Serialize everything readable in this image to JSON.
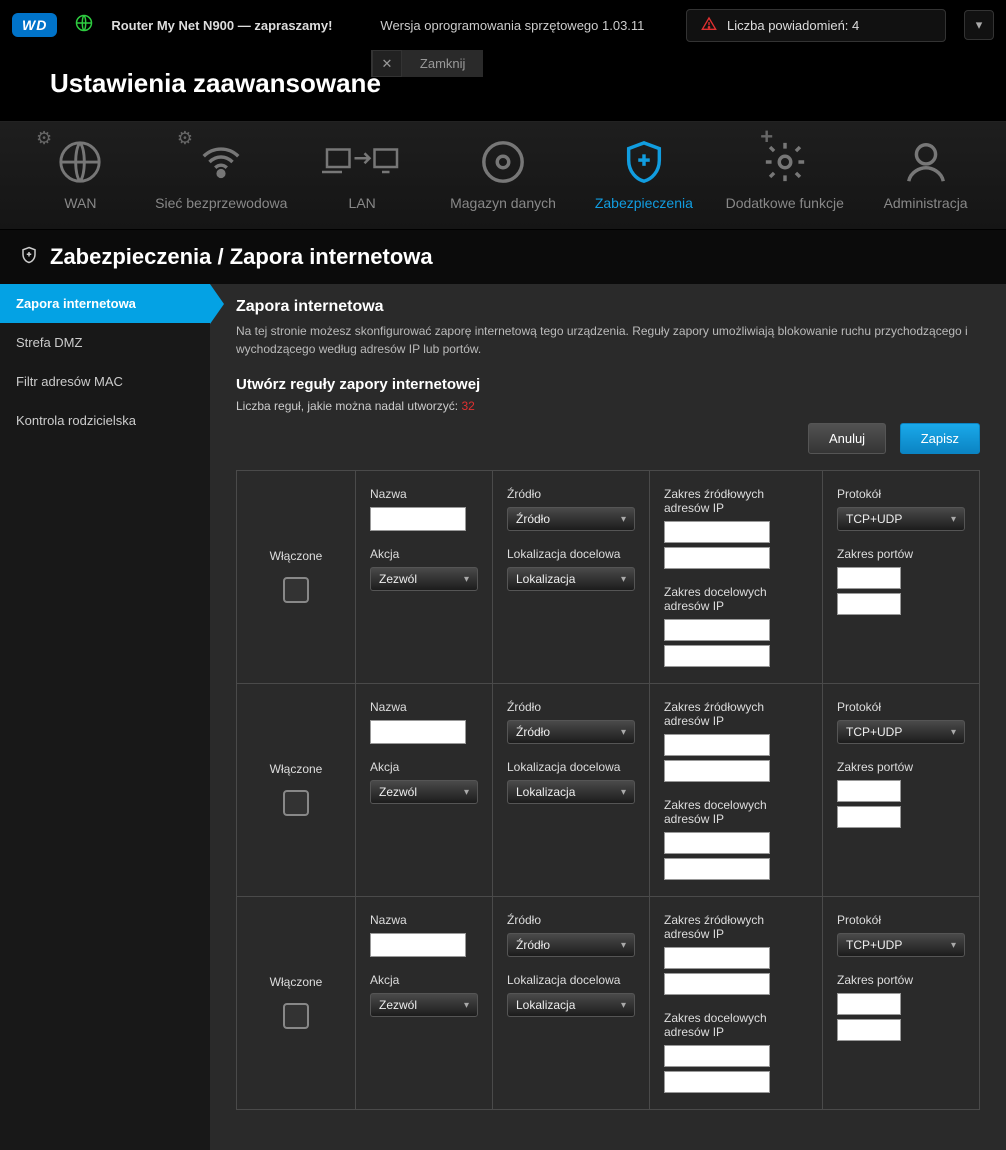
{
  "top": {
    "logo": "WD",
    "welcome": "Router My Net N900 — zapraszamy!",
    "firmware": "Wersja oprogramowania sprzętowego 1.03.11",
    "notif_label": "Liczba powiadomień:",
    "notif_count": "4"
  },
  "title": "Ustawienia zaawansowane",
  "close_label": "Zamknij",
  "nav": {
    "wan": "WAN",
    "wireless": "Sieć bezprzewodowa",
    "lan": "LAN",
    "storage": "Magazyn danych",
    "security": "Zabezpieczenia",
    "features": "Dodatkowe funkcje",
    "admin": "Administracja"
  },
  "breadcrumb": "Zabezpieczenia / Zapora internetowa",
  "sidebar": {
    "firewall": "Zapora internetowa",
    "dmz": "Strefa DMZ",
    "mac": "Filtr adresów MAC",
    "parental": "Kontrola rodzicielska"
  },
  "section": {
    "title": "Zapora internetowa",
    "desc": "Na tej stronie możesz skonfigurować zaporę internetową tego urządzenia. Reguły zapory umożliwiają blokowanie ruchu przychodzącego i wychodzącego według adresów IP lub portów.",
    "create_title": "Utwórz reguły zapory internetowej",
    "remain_lbl": "Liczba reguł, jakie można nadal utworzyć:",
    "remain_val": "32"
  },
  "buttons": {
    "cancel": "Anuluj",
    "save": "Zapisz"
  },
  "fields": {
    "enabled": "Włączone",
    "name": "Nazwa",
    "action": "Akcja",
    "action_val": "Zezwól",
    "source": "Źródło",
    "source_val": "Źródło",
    "dest": "Lokalizacja docelowa",
    "dest_val": "Lokalizacja",
    "src_ip": "Zakres źródłowych adresów IP",
    "dst_ip": "Zakres docelowych adresów IP",
    "protocol": "Protokół",
    "protocol_val": "TCP+UDP",
    "port_range": "Zakres portów"
  }
}
